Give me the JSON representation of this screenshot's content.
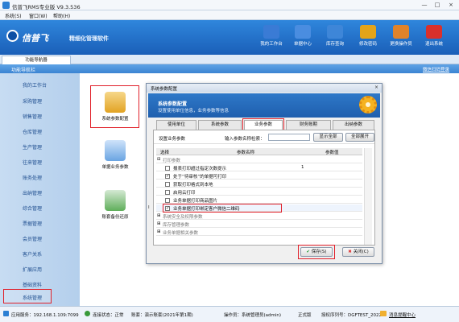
{
  "window": {
    "title": "信普飞RMS专业版 V9.3.536",
    "controls": [
      "—",
      "□",
      "×"
    ]
  },
  "menu": [
    "系统(S)",
    "窗口(W)",
    "帮助(H)"
  ],
  "banner": {
    "brand": "信普飞",
    "slogan": "精细化管理软件"
  },
  "toolbar": [
    {
      "label": "我的工作台",
      "icon": "monitor-icon",
      "color": "#3a7bd5"
    },
    {
      "label": "单据中心",
      "icon": "document-icon",
      "color": "#4a8de0"
    },
    {
      "label": "库存查询",
      "icon": "warehouse-icon",
      "color": "#3e86d8"
    },
    {
      "label": "修改密码",
      "icon": "lock-icon",
      "color": "#e3a419"
    },
    {
      "label": "更换操作员",
      "icon": "user-icon",
      "color": "#e0832a"
    },
    {
      "label": "退出系统",
      "icon": "close-icon",
      "color": "#d9302c"
    }
  ],
  "tabstrip": {
    "tab": "功能导航器"
  },
  "nav_header": {
    "title": "功能导航栏",
    "right_link": "微信扫码登录"
  },
  "sidebar": [
    "我的工作台",
    "采购管理",
    "销售管理",
    "仓库管理",
    "生产管理",
    "往来管理",
    "账务处理",
    "出纳管理",
    "综合管理",
    "票据管理",
    "会员管理",
    "客户关系",
    "扩展应用",
    "基础资料",
    "系统管理"
  ],
  "modules": [
    {
      "label": "系统参数配置",
      "icon": "database-gear-icon"
    },
    {
      "label": "单据业务参数",
      "icon": "document-tools-icon"
    },
    {
      "label": "账套备份还原",
      "icon": "database-restore-icon"
    }
  ],
  "dialog": {
    "title": "系统参数配置",
    "close": "×",
    "header_title": "系统参数配置",
    "header_sub": "设置使用单位信息，业务参数等信息",
    "tabs": [
      "使用单位",
      "系统参数",
      "业务参数",
      "财务账期",
      "出纳参数"
    ],
    "search_label": "设置业务参数",
    "search_prompt": "输入参数名称检索：",
    "search_value": "",
    "show_all": "显示全部",
    "expand_all": "全部展开",
    "columns": [
      "选择",
      "参数名称",
      "参数值"
    ],
    "rows": [
      {
        "kind": "group",
        "name": "打印参数",
        "mark": "⊟"
      },
      {
        "kind": "item",
        "checked": false,
        "name": "报表打印超过指定次数提示",
        "value": "1"
      },
      {
        "kind": "item",
        "checked": true,
        "name": "处于“待审核”的单据可打印",
        "value": ""
      },
      {
        "kind": "item",
        "checked": false,
        "name": "获取打印格式到本地",
        "value": ""
      },
      {
        "kind": "item",
        "checked": false,
        "name": "启用云打印",
        "value": ""
      },
      {
        "kind": "item",
        "checked": false,
        "name": "业务单据打印商品图片",
        "value": ""
      },
      {
        "kind": "item",
        "checked": true,
        "name": "业务单据打印绑定客户微信二维码",
        "value": "",
        "selected": true
      },
      {
        "kind": "group",
        "name": "系统安全及权限参数",
        "mark": "⊞"
      },
      {
        "kind": "group",
        "name": "库存管理参数",
        "mark": "⊞"
      },
      {
        "kind": "group",
        "name": "业务单据相关参数",
        "mark": "⊞"
      }
    ],
    "save": "保存(S)",
    "close_btn": "关闭(C)"
  },
  "status": {
    "server": "应用服务：192.168.1.109:7099",
    "connection": "连接状态：正常",
    "account": "账套：演示账套(2021年第1期)",
    "operator": "操作员：系统管理员(admin)",
    "edition": "正式版",
    "license": "授权序列号：DGFTEST_2022",
    "message": "消息提醒中心"
  }
}
